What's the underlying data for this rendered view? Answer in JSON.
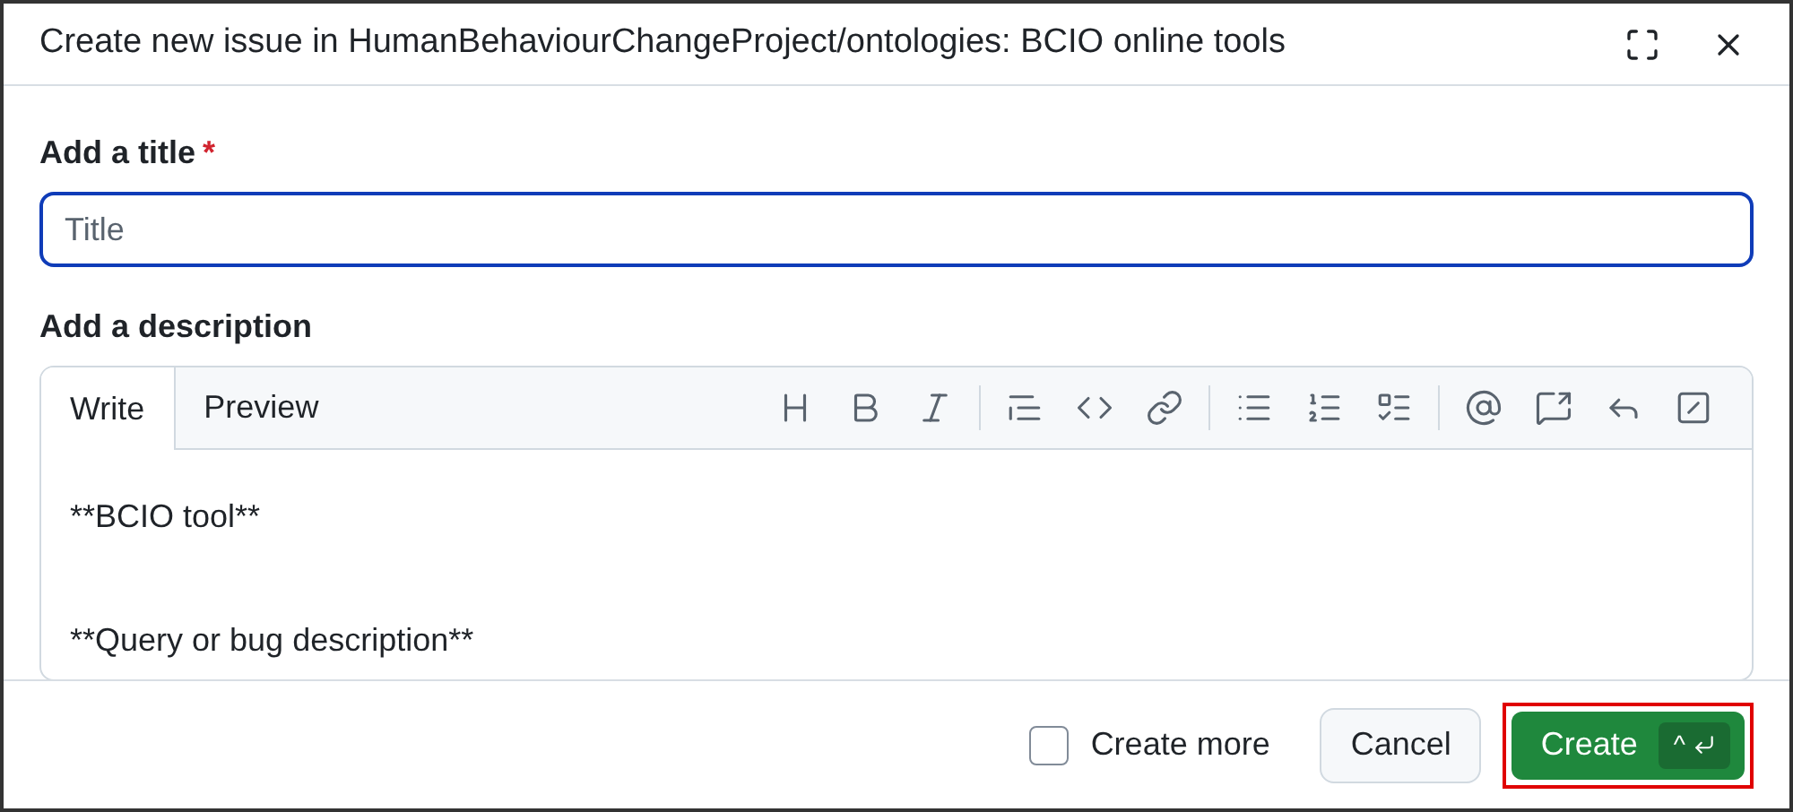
{
  "window": {
    "title": "Create new issue in HumanBehaviourChangeProject/ontologies: BCIO online tools"
  },
  "title_field": {
    "label": "Add a title",
    "required_mark": "*",
    "placeholder": "Title",
    "focused": true
  },
  "description": {
    "label": "Add a description",
    "tabs": [
      {
        "label": "Write",
        "selected": true
      },
      {
        "label": "Preview",
        "selected": false
      }
    ],
    "toolbar": [
      [
        {
          "kind": "heading"
        },
        {
          "kind": "bold"
        },
        {
          "kind": "italic"
        }
      ],
      [
        {
          "kind": "quote"
        },
        {
          "kind": "code"
        },
        {
          "kind": "link"
        }
      ],
      [
        {
          "kind": "bullets"
        },
        {
          "kind": "numbers"
        },
        {
          "kind": "tasks"
        }
      ],
      [
        {
          "kind": "mention"
        },
        {
          "kind": "reference"
        },
        {
          "kind": "reply"
        },
        {
          "kind": "slash"
        }
      ]
    ],
    "paragraphs": [
      "**BCIO tool**",
      "**Query or bug description**"
    ]
  },
  "create_more": {
    "label": "Create more",
    "checked": false
  },
  "cancel": {
    "label": "Cancel"
  },
  "create": {
    "label": "Create",
    "shortcut": "^",
    "highlighted": true
  }
}
